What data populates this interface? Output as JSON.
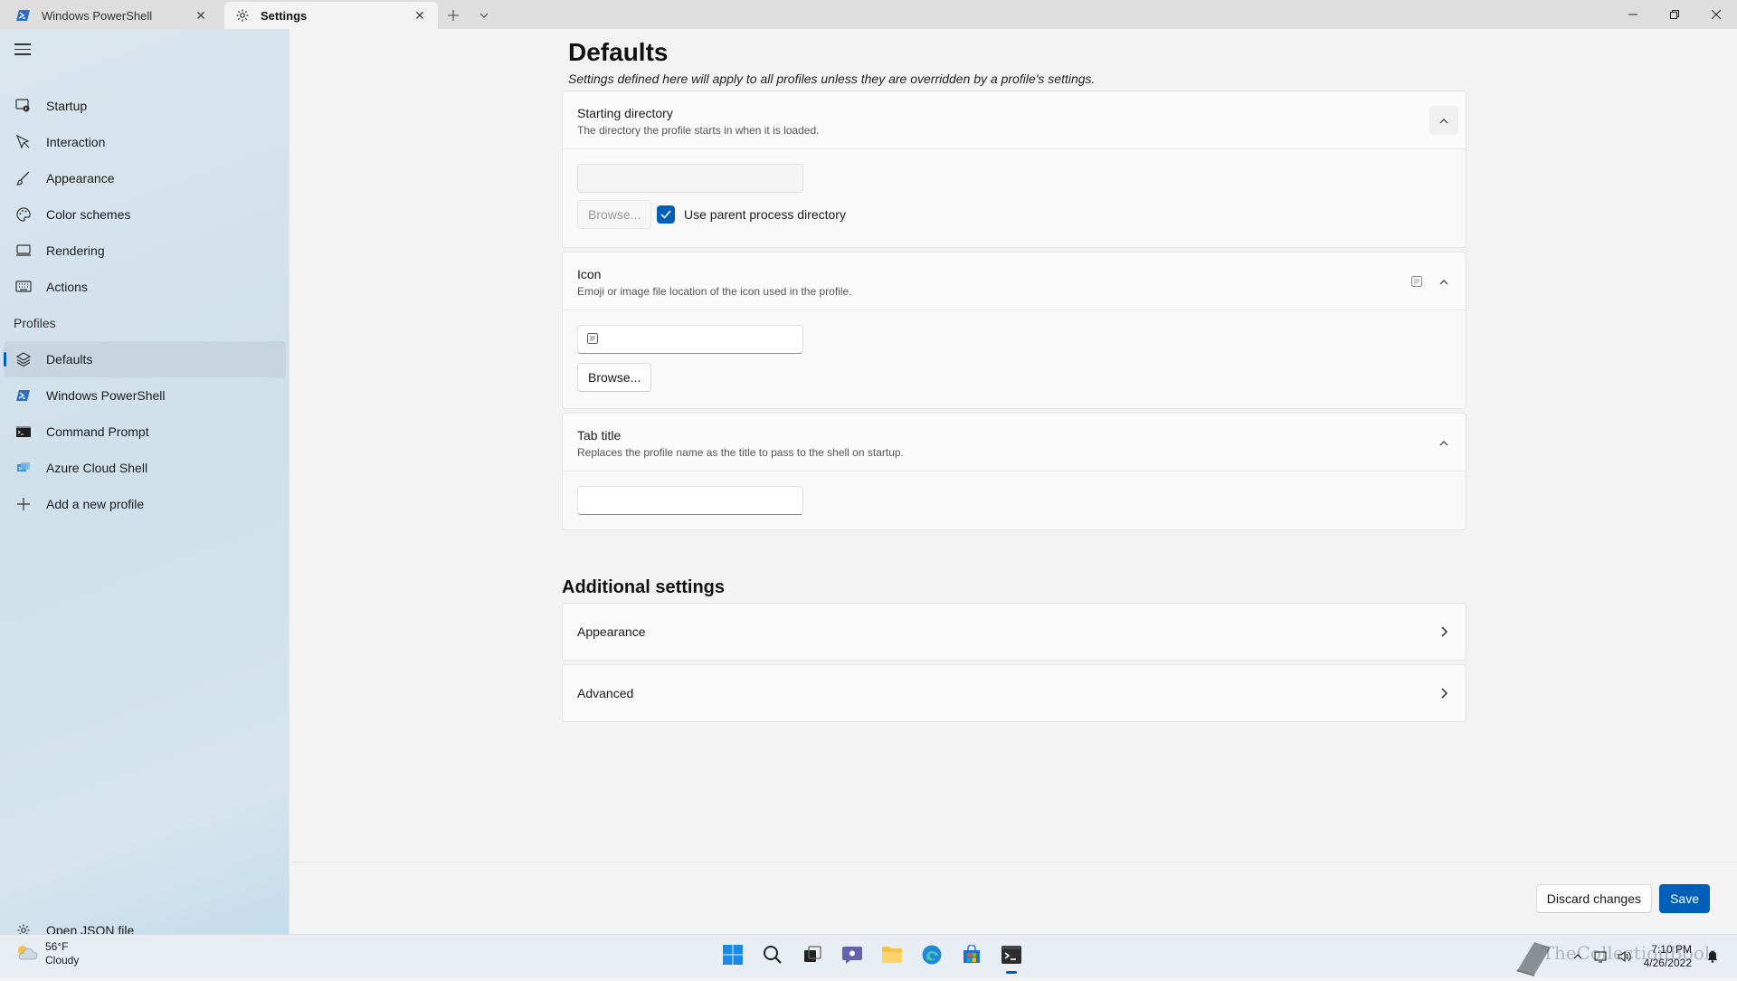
{
  "tabs": [
    {
      "label": "Windows PowerShell",
      "icon": "powershell-icon"
    },
    {
      "label": "Settings",
      "icon": "gear-icon"
    }
  ],
  "sidebar": {
    "items": [
      {
        "label": "Startup",
        "icon": "startup-icon"
      },
      {
        "label": "Interaction",
        "icon": "cursor-icon"
      },
      {
        "label": "Appearance",
        "icon": "paintbrush-icon"
      },
      {
        "label": "Color schemes",
        "icon": "palette-icon"
      },
      {
        "label": "Rendering",
        "icon": "monitor-icon"
      },
      {
        "label": "Actions",
        "icon": "keyboard-icon"
      }
    ],
    "profiles_header": "Profiles",
    "profiles": [
      {
        "label": "Defaults",
        "icon": "layers-icon",
        "selected": true
      },
      {
        "label": "Windows PowerShell",
        "icon": "powershell-icon"
      },
      {
        "label": "Command Prompt",
        "icon": "cmd-icon"
      },
      {
        "label": "Azure Cloud Shell",
        "icon": "azure-icon"
      },
      {
        "label": "Add a new profile",
        "icon": "plus-icon"
      }
    ],
    "open_json": {
      "label": "Open JSON file",
      "icon": "gear-icon"
    }
  },
  "main": {
    "title": "Defaults",
    "subtitle": "Settings defined here will apply to all profiles unless they are overridden by a profile's settings.",
    "starting_directory": {
      "title": "Starting directory",
      "description": "The directory the profile starts in when it is loaded.",
      "value": "",
      "browse_label": "Browse...",
      "checkbox_label": "Use parent process directory",
      "checkbox_checked": true
    },
    "icon_setting": {
      "title": "Icon",
      "description": "Emoji or image file location of the icon used in the profile.",
      "value": "",
      "browse_label": "Browse..."
    },
    "tab_title": {
      "title": "Tab title",
      "description": "Replaces the profile name as the title to pass to the shell on startup.",
      "value": ""
    },
    "additional_settings": {
      "title": "Additional settings",
      "items": [
        "Appearance",
        "Advanced"
      ]
    }
  },
  "footer": {
    "discard_label": "Discard changes",
    "save_label": "Save"
  },
  "taskbar": {
    "weather_temp": "56°F",
    "weather_desc": "Cloudy",
    "time": "7:10 PM",
    "date": "4/26/2022",
    "watermark": "TheCollectionBook"
  },
  "colors": {
    "accent": "#005fb8",
    "sidebar_bg": "#d3e3ed",
    "content_bg": "#f3f3f3"
  }
}
